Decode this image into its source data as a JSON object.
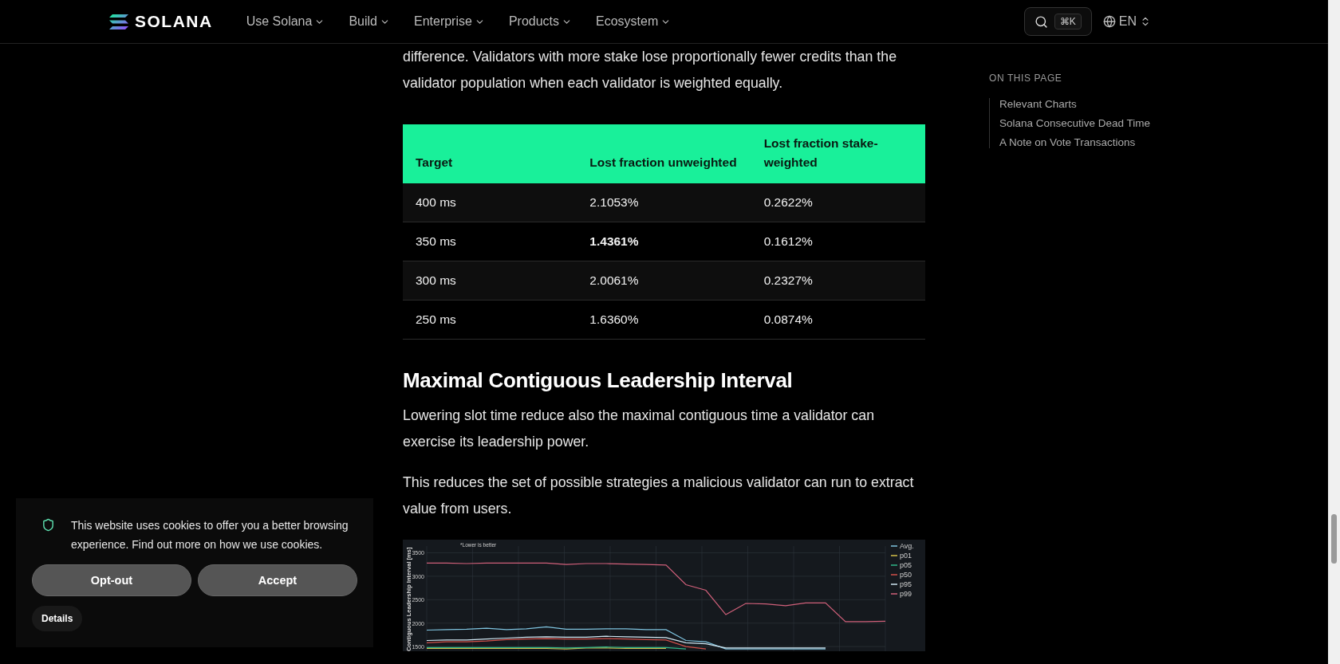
{
  "header": {
    "logo": "SOLANA",
    "nav": [
      {
        "label": "Use Solana"
      },
      {
        "label": "Build"
      },
      {
        "label": "Enterprise"
      },
      {
        "label": "Products"
      },
      {
        "label": "Ecosystem"
      }
    ],
    "search_shortcut": "⌘K",
    "language": "EN"
  },
  "article": {
    "intro": "difference. Validators with more stake lose proportionally fewer credits than the validator population when each validator is weighted equally.",
    "table": {
      "columns": [
        "Target",
        "Lost fraction unweighted",
        "Lost fraction stake-weighted"
      ],
      "rows": [
        {
          "cells": [
            {
              "text": "400 ms",
              "bold": false
            },
            {
              "text": "2.1053%",
              "bold": false
            },
            {
              "text": "0.2622%",
              "bold": false
            }
          ]
        },
        {
          "cells": [
            {
              "text": "350 ms",
              "bold": false
            },
            {
              "text": "1.4361%",
              "bold": true
            },
            {
              "text": "0.1612%",
              "bold": false
            }
          ]
        },
        {
          "cells": [
            {
              "text": "300 ms",
              "bold": false
            },
            {
              "text": "2.0061%",
              "bold": false
            },
            {
              "text": "0.2327%",
              "bold": false
            }
          ]
        },
        {
          "cells": [
            {
              "text": "250 ms",
              "bold": false
            },
            {
              "text": "1.6360%",
              "bold": false
            },
            {
              "text": "0.0874%",
              "bold": false
            }
          ]
        }
      ]
    },
    "heading": "Maximal Contiguous Leadership Interval",
    "paragraphs": [
      "Lowering slot time reduce also the maximal contiguous time a validator can exercise its leadership power.",
      "This reduces the set of possible strategies a malicious validator can run to extract value from users."
    ],
    "chart_data": {
      "type": "line",
      "ylabel": "Contiguous Leadership Interval [ms]",
      "yticks": [
        1500,
        2000,
        2500,
        3000,
        3500
      ],
      "ylim": [
        1400,
        3780
      ],
      "grid": true,
      "legend": "top right",
      "annotations": [
        "*Lower is better"
      ],
      "series": [
        {
          "name": "Avg.",
          "color": "#7fc4e0",
          "values": [
            1850,
            1860,
            1870,
            1890,
            1860,
            1880,
            1920,
            1870,
            1870,
            1880,
            1880,
            1860,
            1860,
            1630,
            1600,
            1450,
            1450,
            1450,
            1450,
            1450,
            1450,
            null,
            null,
            null
          ]
        },
        {
          "name": "p01",
          "color": "#d4c04a",
          "values": [
            1460,
            1460,
            1460,
            1460,
            1460,
            1460,
            1460,
            1450,
            1470,
            1470,
            1460,
            1460,
            1460,
            null,
            null,
            null,
            null,
            null,
            null,
            null,
            null,
            null,
            null,
            null
          ]
        },
        {
          "name": "p05",
          "color": "#2fb88a",
          "values": [
            1480,
            1480,
            1480,
            1480,
            1480,
            1480,
            1480,
            1470,
            1480,
            1490,
            1480,
            1480,
            1480,
            1450,
            null,
            null,
            null,
            null,
            null,
            null,
            null,
            null,
            null,
            null
          ]
        },
        {
          "name": "p50",
          "color": "#d2504a",
          "values": [
            1580,
            1600,
            1600,
            1620,
            1650,
            1660,
            1670,
            1660,
            1660,
            1670,
            1660,
            1650,
            1640,
            1500,
            1450,
            null,
            null,
            null,
            null,
            null,
            null,
            null,
            null,
            null
          ]
        },
        {
          "name": "p95",
          "color": "#cfe6f2",
          "values": [
            1630,
            1640,
            1640,
            1660,
            1680,
            1700,
            1710,
            1700,
            1700,
            1720,
            1710,
            1700,
            1690,
            1580,
            1560,
            1470,
            1470,
            1470,
            1470,
            1470,
            1470,
            null,
            null,
            null
          ]
        },
        {
          "name": "p99",
          "color": "#d0607a",
          "values": [
            3280,
            3280,
            3270,
            3280,
            3280,
            3280,
            3280,
            3250,
            3270,
            3270,
            3260,
            3250,
            3240,
            2820,
            2700,
            2180,
            2420,
            2410,
            2370,
            2430,
            2430,
            2030,
            2030,
            2040
          ]
        }
      ]
    }
  },
  "toc": {
    "title": "ON THIS PAGE",
    "items": [
      {
        "label": "Relevant Charts"
      },
      {
        "label": "Solana Consecutive Dead Time"
      },
      {
        "label": "A Note on Vote Transactions"
      }
    ]
  },
  "cookie_banner": {
    "message": "This website uses cookies to offer you a better browsing experience. Find out more on how we use cookies.",
    "buttons": [
      "Opt-out",
      "Accept"
    ],
    "details": "Details"
  }
}
